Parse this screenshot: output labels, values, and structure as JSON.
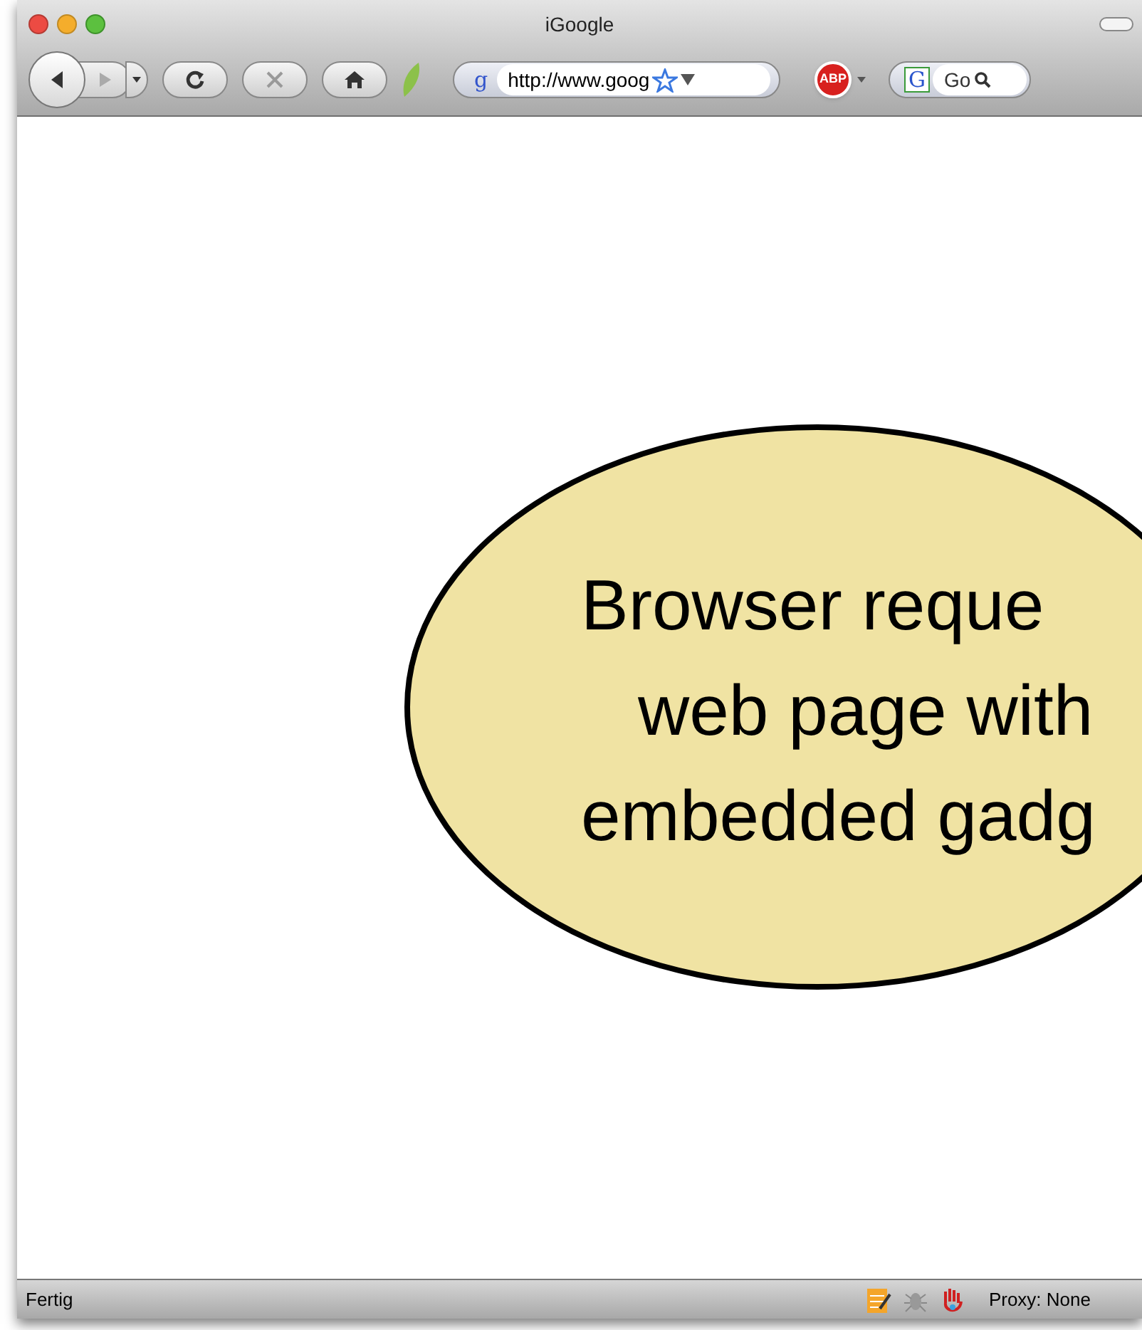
{
  "window": {
    "title": "iGoogle"
  },
  "toolbar": {
    "address": {
      "site_icon": "g",
      "value": "http://www.goog"
    },
    "search": {
      "engine_icon": "G",
      "value": "Go"
    },
    "adblock_badge": "ABP"
  },
  "callout": {
    "lines": [
      "Browser reque",
      "web page with",
      "embedded gadg"
    ]
  },
  "status_bar": {
    "text": "Fertig",
    "proxy": "Proxy: None"
  }
}
